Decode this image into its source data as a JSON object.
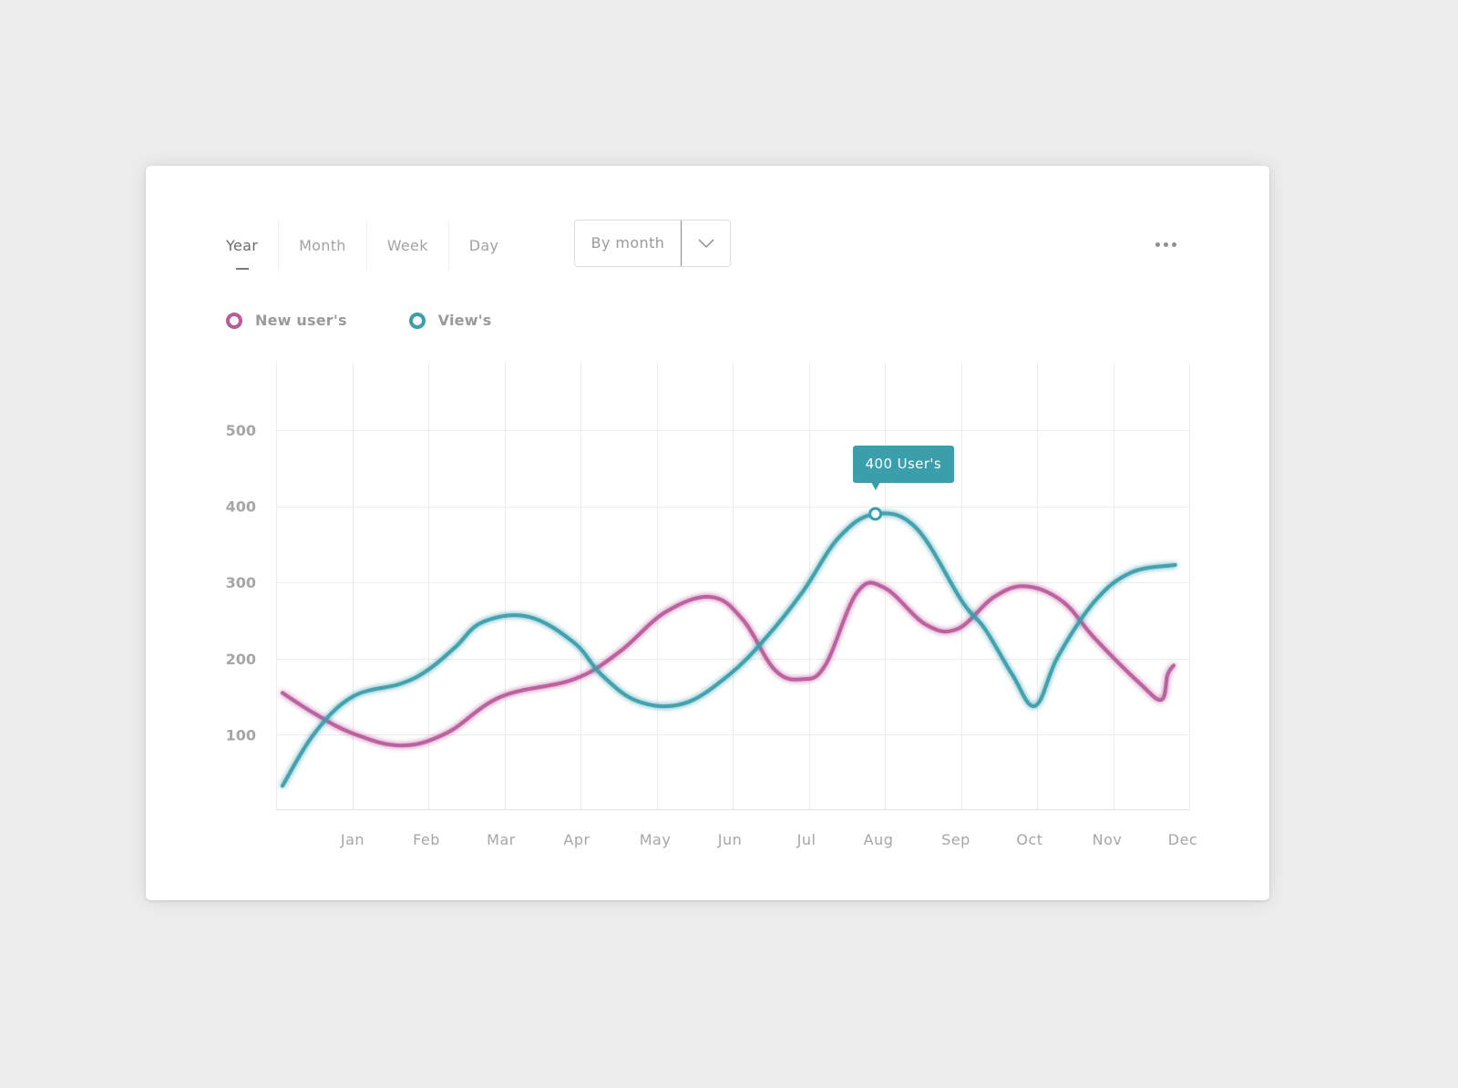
{
  "tabs": [
    {
      "label": "Year",
      "active": true
    },
    {
      "label": "Month",
      "active": false
    },
    {
      "label": "Week",
      "active": false
    },
    {
      "label": "Day",
      "active": false
    }
  ],
  "group_select": {
    "value": "By month",
    "icon": "chevron-down-icon"
  },
  "more_menu": {
    "icon": "more-horizontal-icon"
  },
  "colors": {
    "new_users": "#b95a9b",
    "views": "#3a9eab",
    "grid": "#ececec",
    "axis_text": "#a6a6a6"
  },
  "chart_data": {
    "type": "line",
    "smooth": true,
    "title": "",
    "xlabel": "",
    "ylabel": "",
    "ylim": [
      0,
      580
    ],
    "yticks": [
      100,
      200,
      300,
      400,
      500
    ],
    "xlim": [
      -0.1,
      11.7
    ],
    "categories": [
      "Jan",
      "Feb",
      "Mar",
      "Apr",
      "May",
      "Jun",
      "Jul",
      "Aug",
      "Sep",
      "Oct",
      "Nov",
      "Dec"
    ],
    "grid": true,
    "legend": "top-left",
    "series": [
      {
        "name": "New user's",
        "color": "#b95a9b",
        "x": [
          0.0,
          0.42,
          0.92,
          1.55,
          2.15,
          2.87,
          3.83,
          4.43,
          5.03,
          5.63,
          6.05,
          6.47,
          6.83,
          7.13,
          7.55,
          7.91,
          8.45,
          8.87,
          9.35,
          9.77,
          10.25,
          10.67,
          11.27,
          11.55,
          11.63,
          11.71
        ],
        "values": [
          155,
          128,
          102,
          86,
          102,
          150,
          173,
          209,
          261,
          281,
          251,
          185,
          173,
          191,
          287,
          293,
          245,
          239,
          281,
          295,
          275,
          227,
          167,
          146,
          179,
          191
        ]
      },
      {
        "name": "View's",
        "color": "#3a9eab",
        "x": [
          0.0,
          0.42,
          0.92,
          1.55,
          1.91,
          2.27,
          2.63,
          3.23,
          3.83,
          4.19,
          4.67,
          5.27,
          5.87,
          6.35,
          6.83,
          7.31,
          7.79,
          8.33,
          8.93,
          9.23,
          9.59,
          9.89,
          10.19,
          10.67,
          11.15,
          11.73
        ],
        "values": [
          33,
          102,
          150,
          167,
          185,
          215,
          248,
          255,
          221,
          179,
          144,
          141,
          179,
          227,
          287,
          359,
          390,
          371,
          275,
          239,
          179,
          138,
          203,
          275,
          313,
          323
        ]
      }
    ],
    "annotation": {
      "series": "View's",
      "x": 7.79,
      "value": 390,
      "label": "400 User's"
    }
  }
}
